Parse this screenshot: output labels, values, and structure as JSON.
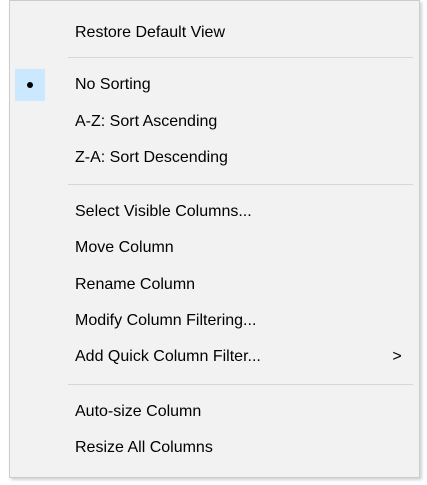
{
  "menu": {
    "items": [
      {
        "label": "Restore Default View"
      },
      {
        "label": "No Sorting",
        "checked": true
      },
      {
        "label": "A-Z: Sort Ascending"
      },
      {
        "label": "Z-A: Sort Descending"
      },
      {
        "label": "Select Visible Columns..."
      },
      {
        "label": "Move Column"
      },
      {
        "label": "Rename Column"
      },
      {
        "label": "Modify Column Filtering..."
      },
      {
        "label": "Add Quick Column Filter...",
        "submenu_icon": "chevron-right-icon",
        "submenu_glyph": ">"
      },
      {
        "label": "Auto-size Column"
      },
      {
        "label": "Resize All Columns"
      }
    ],
    "check_highlight_color": "#cce8ff",
    "background_color": "#f2f2f2"
  }
}
